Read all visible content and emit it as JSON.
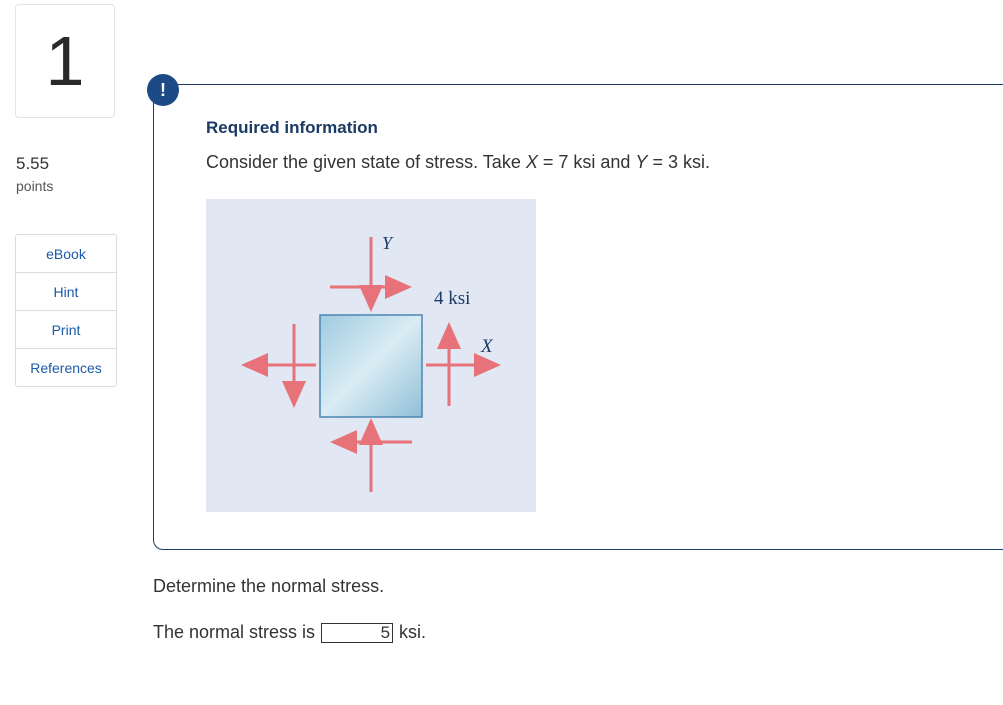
{
  "question": {
    "number": "1",
    "points_value": "5.55",
    "points_label": "points"
  },
  "tools": [
    {
      "label": "eBook"
    },
    {
      "label": "Hint"
    },
    {
      "label": "Print"
    },
    {
      "label": "References"
    }
  ],
  "info": {
    "alert_symbol": "!",
    "title": "Required information",
    "text_part1": "Consider the given state of stress. Take ",
    "var_x": "X",
    "text_part2": " = 7 ksi and ",
    "var_y": "Y",
    "text_part3": " = 3 ksi."
  },
  "figure": {
    "label_y": "Y",
    "label_shear": "4 ksi",
    "label_x": "X"
  },
  "prompt": "Determine the normal stress.",
  "answer": {
    "prefix": "The normal stress is",
    "value": "5",
    "unit": "ksi."
  },
  "colors": {
    "accent": "#1b4a86",
    "arrow": "#e8727a",
    "figure_bg": "#e1e7f3"
  }
}
